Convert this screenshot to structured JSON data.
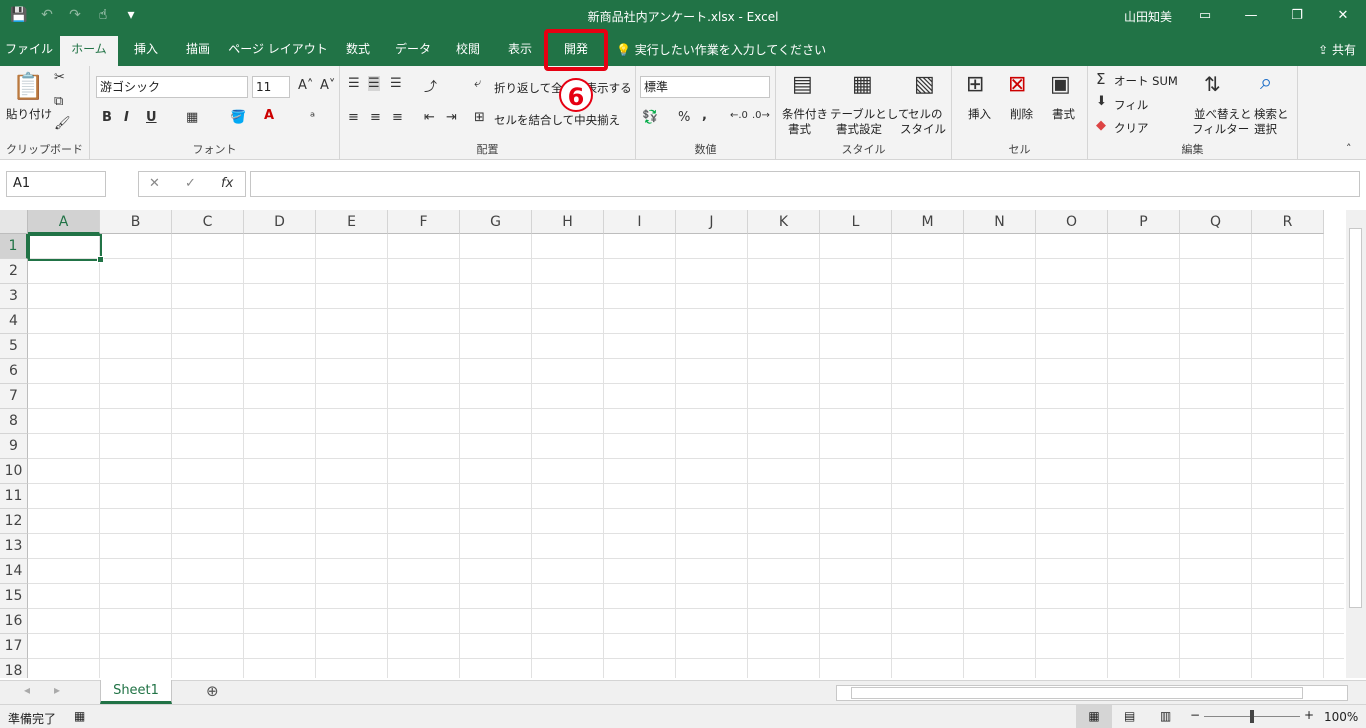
{
  "titlebar": {
    "title": "新商品社内アンケート.xlsx  -  Excel",
    "user": "山田知美",
    "qat": {
      "save": "💾",
      "undo": "↶",
      "redo": "↷",
      "touch": "☝",
      "more": "▾",
      "customize": "⌄"
    },
    "win_buttons": {
      "ribbon_opts": "▭",
      "minimize": "—",
      "restore": "❐",
      "close": "✕"
    }
  },
  "tabs": [
    {
      "label": "ファイル"
    },
    {
      "label": "ホーム"
    },
    {
      "label": "挿入"
    },
    {
      "label": "描画"
    },
    {
      "label": "ページ レイアウト"
    },
    {
      "label": "数式"
    },
    {
      "label": "データ"
    },
    {
      "label": "校閲"
    },
    {
      "label": "表示"
    },
    {
      "label": "開発"
    }
  ],
  "tell_me": "実行したい作業を入力してください",
  "share": "共有",
  "step_badge": "6",
  "ribbon": {
    "clipboard": {
      "paste": "貼り付け",
      "label": "クリップボード"
    },
    "font": {
      "name": "游ゴシック",
      "size": "11",
      "bold": "B",
      "italic": "I",
      "underline": "U",
      "label": "フォント"
    },
    "alignment": {
      "wrap": "折り返して全体を表示する",
      "merge": "セルを結合して中央揃え",
      "label": "配置"
    },
    "number": {
      "format": "標準",
      "percent": "%",
      "comma": ",",
      "label": "数値"
    },
    "styles": {
      "conditional": [
        "条件付き",
        "書式"
      ],
      "table": [
        "テーブルとして",
        "書式設定"
      ],
      "cell": [
        "セルの",
        "スタイル"
      ],
      "label": "スタイル"
    },
    "cells": {
      "insert": "挿入",
      "delete": "削除",
      "format": "書式",
      "label": "セル"
    },
    "editing": {
      "autosum": "オート SUM",
      "fill": "フィル",
      "clear": "クリア",
      "sort": [
        "並べ替えと",
        "フィルター"
      ],
      "find": [
        "検索と",
        "選択"
      ],
      "label": "編集"
    }
  },
  "formula_bar": {
    "name_box": "A1",
    "cancel": "✕",
    "enter": "✓",
    "fx": "fx",
    "value": ""
  },
  "columns": [
    "A",
    "B",
    "C",
    "D",
    "E",
    "F",
    "G",
    "H",
    "I",
    "J",
    "K",
    "L",
    "M",
    "N",
    "O",
    "P",
    "Q",
    "R"
  ],
  "rows": [
    "1",
    "2",
    "3",
    "4",
    "5",
    "6",
    "7",
    "8",
    "9",
    "10",
    "11",
    "12",
    "13",
    "14",
    "15",
    "16",
    "17",
    "18"
  ],
  "sheets": [
    {
      "name": "Sheet1"
    }
  ],
  "status": {
    "ready": "準備完了",
    "zoom": "100%"
  }
}
